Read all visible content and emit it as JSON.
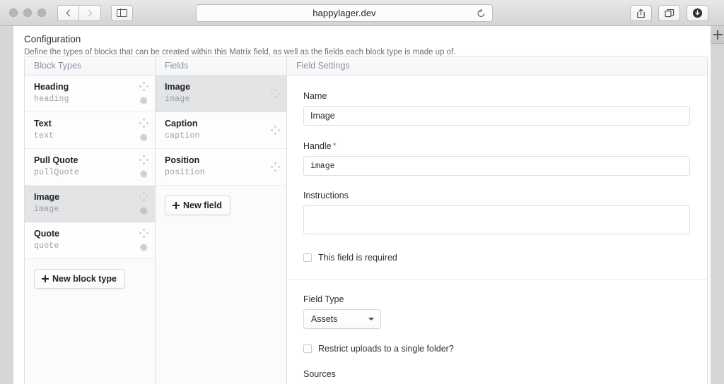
{
  "browser": {
    "url": "happylager.dev",
    "back_icon": "back-chevron-icon",
    "forward_icon": "forward-chevron-icon",
    "sidebar_icon": "sidebar-toggle-icon",
    "reload_icon": "reload-icon",
    "share_icon": "share-icon",
    "tabs_icon": "show-tabs-icon",
    "downloads_icon": "downloads-icon",
    "new_tab_icon": "new-tab-plus-icon"
  },
  "page": {
    "title": "Configuration",
    "subtitle": "Define the types of blocks that can be created within this Matrix field, as well as the fields each block type is made up of."
  },
  "columns": {
    "block_types_header": "Block Types",
    "fields_header": "Fields",
    "field_settings_header": "Field Settings"
  },
  "block_types": [
    {
      "name": "Heading",
      "handle": "heading",
      "selected": false
    },
    {
      "name": "Text",
      "handle": "text",
      "selected": false
    },
    {
      "name": "Pull Quote",
      "handle": "pullQuote",
      "selected": false
    },
    {
      "name": "Image",
      "handle": "image",
      "selected": true
    },
    {
      "name": "Quote",
      "handle": "quote",
      "selected": false
    }
  ],
  "fields": [
    {
      "name": "Image",
      "handle": "image",
      "selected": true
    },
    {
      "name": "Caption",
      "handle": "caption",
      "selected": false
    },
    {
      "name": "Position",
      "handle": "position",
      "selected": false
    }
  ],
  "buttons": {
    "new_block_type": "New block type",
    "new_field": "New field"
  },
  "field_settings": {
    "name_label": "Name",
    "name_value": "Image",
    "handle_label": "Handle",
    "handle_required_marker": "*",
    "handle_value": "image",
    "instructions_label": "Instructions",
    "instructions_value": "",
    "required_checkbox_label": "This field is required",
    "required_checked": false,
    "field_type_label": "Field Type",
    "field_type_value": "Assets",
    "restrict_checkbox_label": "Restrict uploads to a single folder?",
    "restrict_checked": false,
    "sources_label": "Sources"
  },
  "colors": {
    "accent_required": "#da5a47",
    "selected_row_bg": "#e3e4e6",
    "header_text": "#8b93a1"
  }
}
